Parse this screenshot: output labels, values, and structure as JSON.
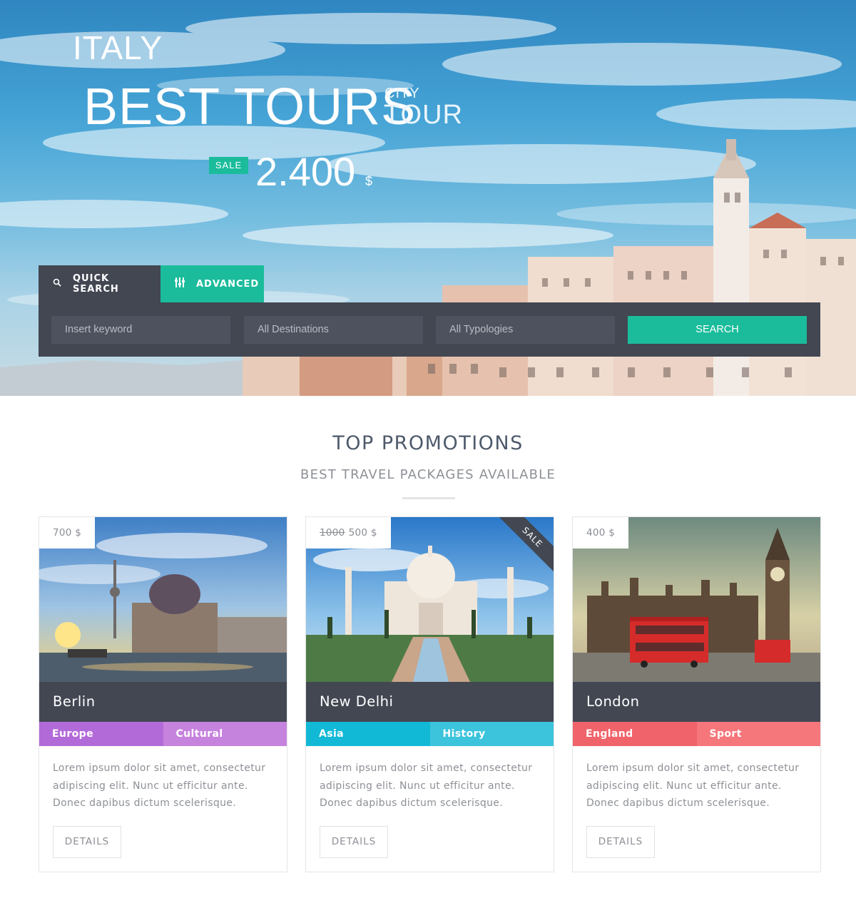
{
  "hero": {
    "country": "ITALY",
    "title": "BEST TOURS",
    "subtitle_small": "CITY",
    "subtitle_large": "TOUR",
    "sale_badge": "SALE",
    "price": "2.400",
    "currency": "$"
  },
  "search": {
    "tabs": [
      {
        "label": "QUICK SEARCH",
        "icon": "search-icon"
      },
      {
        "label": "ADVANCED",
        "icon": "sliders-icon"
      }
    ],
    "keyword_placeholder": "Insert keyword",
    "destinations_value": "All Destinations",
    "typologies_value": "All Typologies",
    "button_label": "SEARCH"
  },
  "section": {
    "title": "TOP PROMOTIONS",
    "subtitle": "BEST TRAVEL PACKAGES AVAILABLE"
  },
  "cards": [
    {
      "price": "700 $",
      "old_price": "",
      "name": "Berlin",
      "tags": [
        "Europe",
        "Cultural"
      ],
      "tag_colors": [
        "#b36ad9",
        "#c683de"
      ],
      "description": "Lorem ipsum dolor sit amet, consectetur adipiscing elit. Nunc ut efficitur ante. Donec dapibus dictum scelerisque.",
      "button": "DETAILS"
    },
    {
      "price": "500 $",
      "old_price": "1000",
      "name": "New Delhi",
      "ribbon": "SALE",
      "tags": [
        "Asia",
        "History"
      ],
      "tag_colors": [
        "#12b9d6",
        "#3bc4dc"
      ],
      "description": "Lorem ipsum dolor sit amet, consectetur adipiscing elit. Nunc ut efficitur ante. Donec dapibus dictum scelerisque.",
      "button": "DETAILS"
    },
    {
      "price": "400 $",
      "old_price": "",
      "name": "London",
      "tags": [
        "England",
        "Sport"
      ],
      "tag_colors": [
        "#f0636a",
        "#f5777c"
      ],
      "description": "Lorem ipsum dolor sit amet, consectetur adipiscing elit. Nunc ut efficitur ante. Donec dapibus dictum scelerisque.",
      "button": "DETAILS"
    }
  ],
  "colors": {
    "accent": "#1bbc9b",
    "dark": "#424752",
    "heading": "#4e5a6b"
  }
}
